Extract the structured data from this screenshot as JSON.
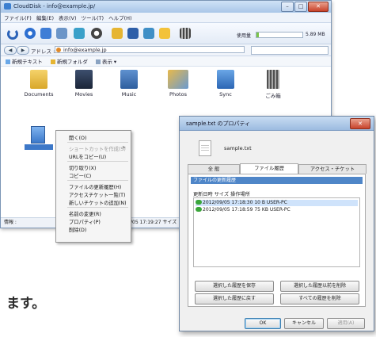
{
  "main_window": {
    "title": "CloudDisk - info@example.jp/",
    "menu": [
      "ファイル(F)",
      "編集(E)",
      "表示(V)",
      "ツール(T)",
      "ヘルプ(H)"
    ],
    "quota": {
      "label": "使用量",
      "value": "5.89 MB",
      "fraction": 0.05
    },
    "address": {
      "back": "◀",
      "forward": "▶",
      "label": "アドレス :",
      "value": "info@example.jp"
    },
    "commands": [
      "新規テキスト",
      "新規フォルダ",
      "表示 ▾"
    ],
    "folders": [
      "Documents",
      "Movies",
      "Music",
      "Photos",
      "Sync",
      "ごみ箱"
    ],
    "status": {
      "left": "情報 : ",
      "right": "/05 17:19:27  サイズ"
    }
  },
  "context_menu": {
    "items": [
      {
        "label": "開く(O)",
        "disabled": false
      },
      {
        "label": "ショートカットを作成(S)",
        "disabled": true,
        "submenu": true
      },
      {
        "label": "URLをコピー(U)",
        "disabled": false
      },
      {
        "label": "切り取り(X)",
        "disabled": false
      },
      {
        "label": "コピー(C)",
        "disabled": false
      },
      {
        "label": "ファイルの更新履歴(H)",
        "disabled": false
      },
      {
        "label": "アクセスチケット一覧(T)",
        "disabled": false
      },
      {
        "label": "新しいチケットの追加(N)",
        "disabled": false
      },
      {
        "label": "名前の変更(R)",
        "disabled": false
      },
      {
        "label": "プロパティ(P)",
        "disabled": false
      },
      {
        "label": "削除(D)",
        "disabled": false
      }
    ]
  },
  "caption": "ます。",
  "dialog": {
    "title": "sample.txt のプロパティ",
    "close": "✕",
    "file_name": "sample.txt",
    "tabs": [
      "全 般",
      "ファイル履歴",
      "アクセス・チケット"
    ],
    "panel_header": "ファイルの更新履歴",
    "columns": "更新日時            サイズ  操作場所",
    "rows": [
      "2012/09/05 17:18:30   10 B   USER-PC",
      "2012/09/05 17:18:59   75 KB  USER-PC"
    ],
    "panel_buttons": [
      "選択した履歴を保存",
      "選択した履歴以前を削除",
      "選択した履歴に戻す",
      "すべての履歴を削除"
    ],
    "buttons": [
      "OK",
      "キャンセル",
      "適用(A)"
    ]
  },
  "colors": {
    "accent": "#4f86c8",
    "titlebar": "#a9c6e8",
    "close": "#c8432b",
    "quota": "#7cc54a"
  }
}
